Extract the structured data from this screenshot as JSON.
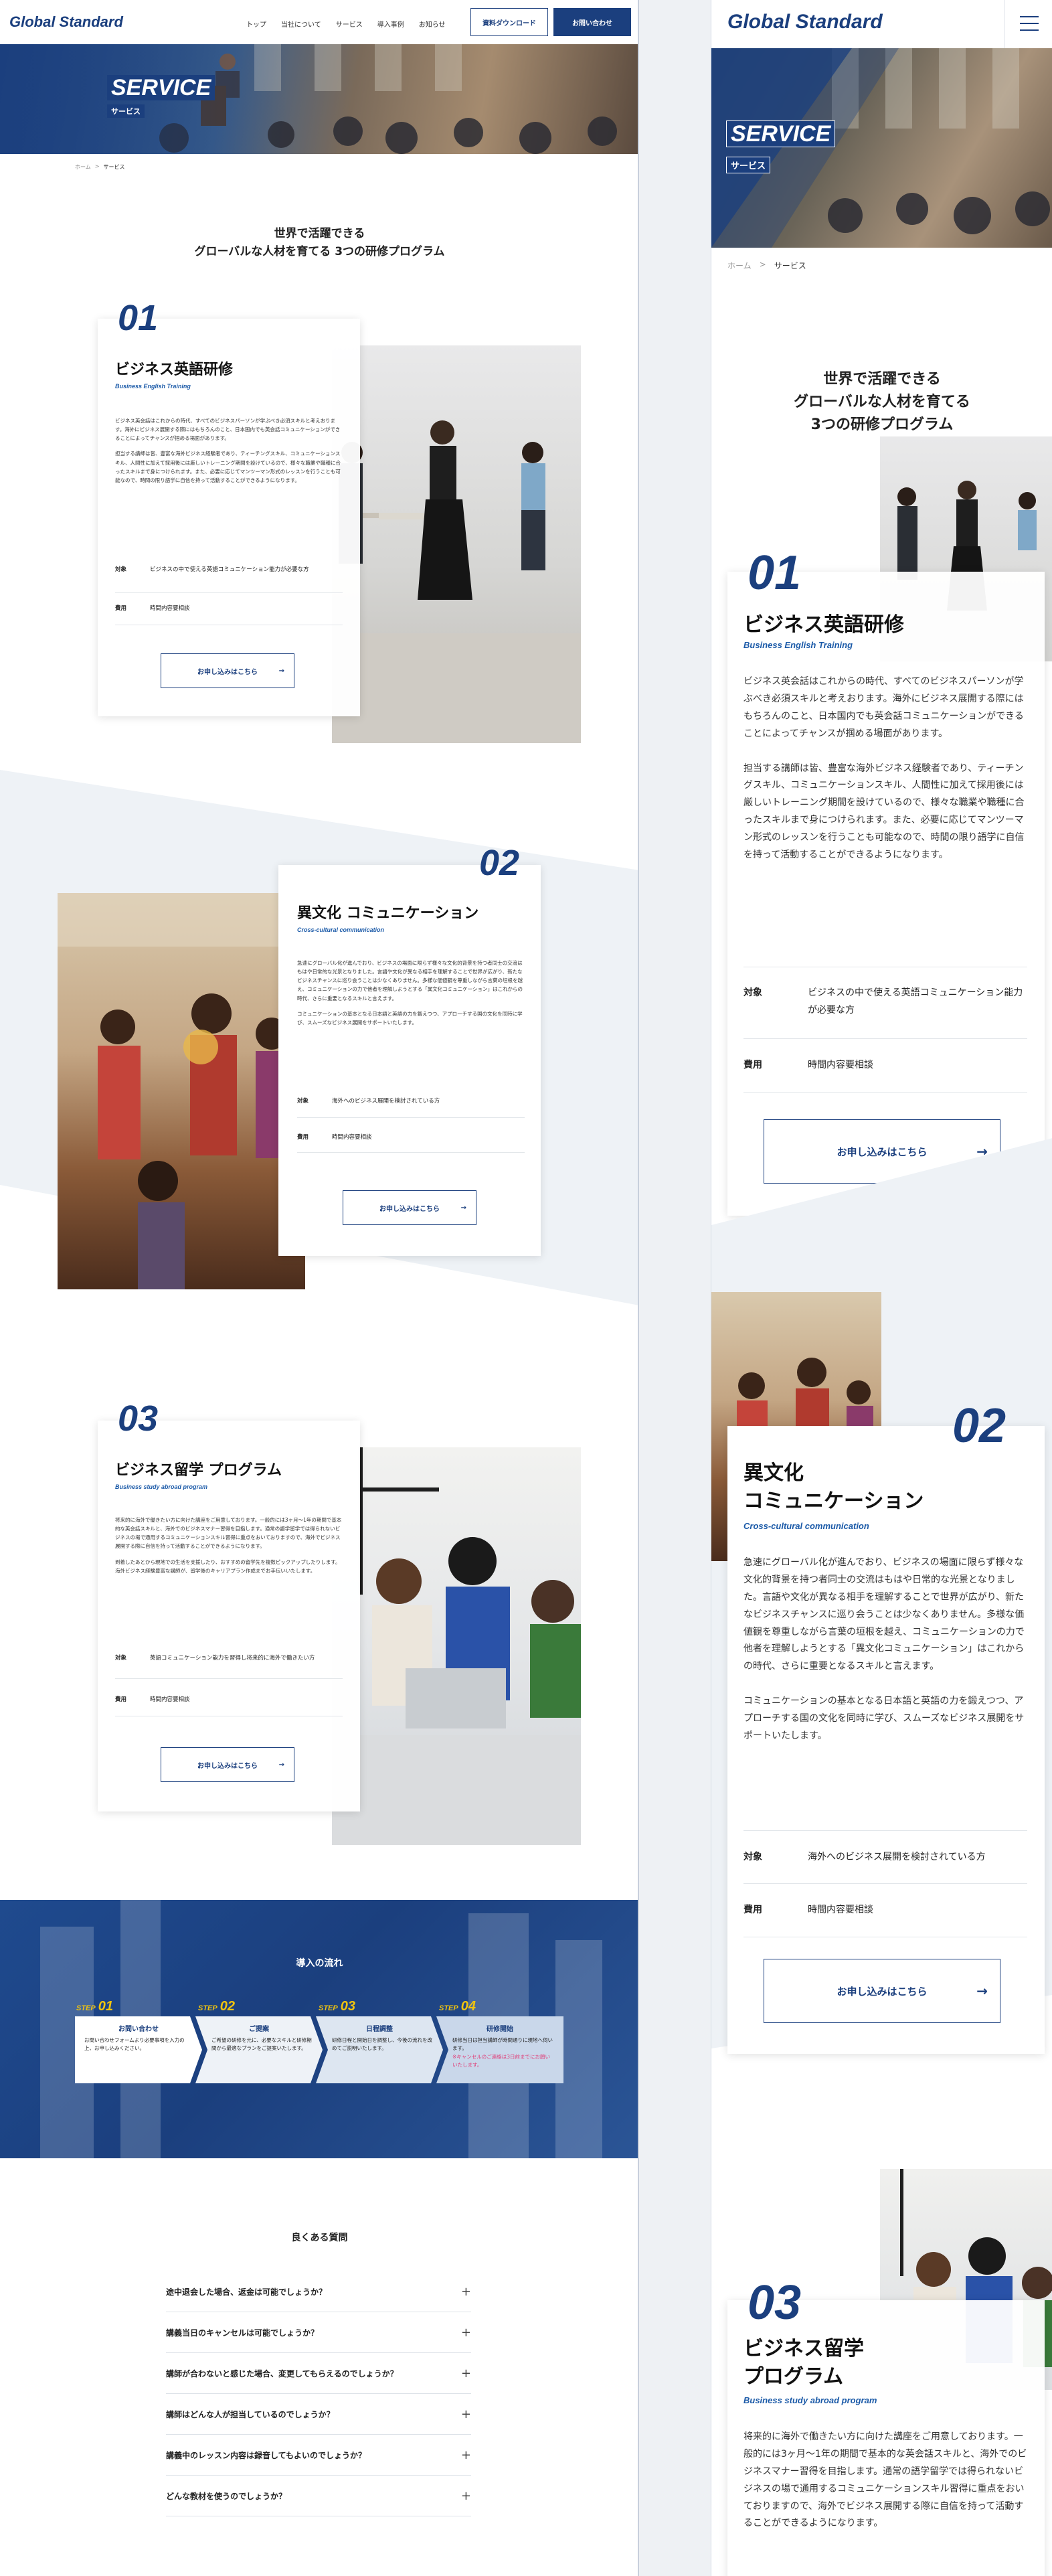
{
  "brand": {
    "logo": "Global Standard",
    "color_primary": "#1b3f7e",
    "color_accent": "#f1c40f"
  },
  "nav": {
    "items": [
      "トップ",
      "当社について",
      "サービス",
      "導入事例",
      "お知らせ"
    ],
    "download_button": "資料ダウンロード",
    "contact_button": "お問い合わせ"
  },
  "hero": {
    "title": "SERVICE",
    "subtitle": "サービス"
  },
  "breadcrumb": {
    "home": "ホーム",
    "separator": ">",
    "current": "サービス"
  },
  "intro": {
    "line1": "世界で活躍できる",
    "line2": "グローバルな人材を育てる",
    "line3": "3つの研修プログラム",
    "pc_line2": "グローバルな人材を育てる 3つの研修プログラム"
  },
  "programs": [
    {
      "number": "01",
      "title": "ビジネス英語研修",
      "subtitle": "Business English Training",
      "body_p1": "ビジネス英会話はこれからの時代、すべてのビジネスパーソンが学ぶべき必須スキルと考えおります。海外にビジネス展開する際にはもちろんのこと、日本国内でも英会話コミュニケーションができることによってチャンスが掴める場面があります。",
      "body_p2": "担当する講師は皆、豊富な海外ビジネス経験者であり、ティーチングスキル、コミュニケーションスキル、人間性に加えて採用後には厳しいトレーニング期間を設けているので、様々な職業や職種に合ったスキルまで身につけられます。また、必要に応じてマンツーマン形式のレッスンを行うことも可能なので、時間の限り語学に自信を持って活動することができるようになります。",
      "target_label": "対象",
      "target_value": "ビジネスの中で使える英語コミュニケーション能力が必要な方",
      "fee_label": "費用",
      "fee_value": "時間内容要相談",
      "cta": "お申し込みはこちら"
    },
    {
      "number": "02",
      "title": "異文化 コミュニケーション",
      "title_sp_line1": "異文化",
      "title_sp_line2": "コミュニケーション",
      "subtitle": "Cross-cultural communication",
      "body_p1": "急速にグローバル化が進んでおり、ビジネスの場面に限らず様々な文化的背景を持つ者同士の交流はもはや日常的な光景となりました。言語や文化が異なる相手を理解することで世界が広がり、新たなビジネスチャンスに巡り会うことは少なくありません。多様な価値観を尊重しながら言葉の垣根を越え、コミュニケーションの力で他者を理解しようとする「異文化コミュニケーション」はこれからの時代、さらに重要となるスキルと言えます。",
      "body_p2": "コミュニケーションの基本となる日本語と英語の力を鍛えつつ、アプローチする国の文化を同時に学び、スムーズなビジネス展開をサポートいたします。",
      "target_label": "対象",
      "target_value": "海外へのビジネス展開を検討されている方",
      "fee_label": "費用",
      "fee_value": "時間内容要相談",
      "cta": "お申し込みはこちら"
    },
    {
      "number": "03",
      "title": "ビジネス留学 プログラム",
      "title_sp_line1": "ビジネス留学",
      "title_sp_line2": "プログラム",
      "subtitle": "Business study abroad program",
      "body_p1": "将来的に海外で働きたい方に向けた講座をご用意しております。一般的には3ヶ月〜1年の期間で基本的な英会話スキルと、海外でのビジネスマナー習得を目指します。通常の語学留学では得られないビジネスの場で通用するコミュニケーションスキル習得に重点をおいておりますので、海外でビジネス展開する際に自信を持って活動することができるようになります。",
      "body_p2": "到着したあとから現地での生活を支援したり、おすすめの留学先を複数ピックアップしたりします。海外ビジネス経験豊富な講師が、留学後のキャリアプラン作成までお手伝いいたします。",
      "target_label": "対象",
      "target_value": "英語コミュニケーション能力を習得し将来的に海外で働きたい方",
      "fee_label": "費用",
      "fee_value": "時間内容要相談",
      "cta": "お申し込みはこちら"
    }
  ],
  "flow": {
    "title": "導入の流れ",
    "step_word": "STEP",
    "steps": [
      {
        "number": "01",
        "title": "お問い合わせ",
        "desc": "お問い合わせフォームより必要事項を入力の上、お申し込みください。"
      },
      {
        "number": "02",
        "title": "ご提案",
        "desc": "ご希望の研修を元に、必要なスキルと研修期間から最適なプランをご提案いたします。"
      },
      {
        "number": "03",
        "title": "日程調整",
        "desc": "研修日程と開始日を調整し、今後の流れを改めてご説明いたします。"
      },
      {
        "number": "04",
        "title": "研修開始",
        "desc": "研修当日は担当講師が時間通りに現地へ伺います。",
        "note": "※キャンセルのご連絡は3日前までにお願いいたします。"
      }
    ]
  },
  "faq": {
    "title": "良くある質問",
    "items": [
      "途中退会した場合、返金は可能でしょうか？",
      "講義当日のキャンセルは可能でしょうか？",
      "講師が合わないと感じた場合、変更してもらえるのでしょうか？",
      "講師はどんな人が担当しているのでしょうか？",
      "講義中のレッスン内容は録音してもよいのでしょうか？",
      "どんな教材を使うのでしょうか？"
    ]
  }
}
